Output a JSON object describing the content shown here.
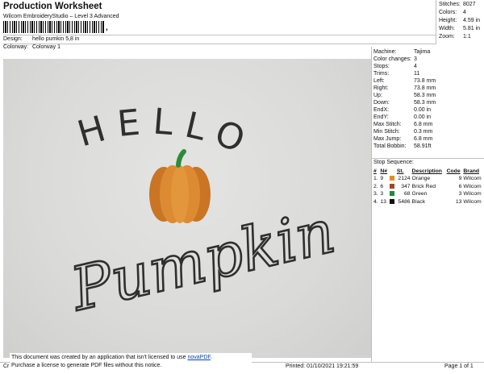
{
  "header": {
    "title": "Production Worksheet",
    "subtitle": "Wilcom EmbroideryStudio – Level 3 Advanced",
    "barcode_suffix": ","
  },
  "meta": {
    "design_label": "Design:",
    "design_value": "hello pumkin 5,8 in",
    "colorway_label": "Colorway:",
    "colorway_value": "Colorway 1"
  },
  "stats": [
    {
      "label": "Stitches:",
      "value": "8027"
    },
    {
      "label": "Colors:",
      "value": "4"
    },
    {
      "label": "Height:",
      "value": "4.59 in"
    },
    {
      "label": "Width:",
      "value": "5.81 in"
    },
    {
      "label": "Zoom:",
      "value": "1:1"
    }
  ],
  "design": {
    "line1": "HELLO",
    "line2": "Pumpkin",
    "colors": {
      "text": "#2f2f2c",
      "pumpkin": "#d98a32",
      "pumpkin_shade": "#b8661c",
      "stem": "#2e8b3a"
    }
  },
  "machine": [
    {
      "k": "Machine:",
      "v": "Tajima"
    },
    {
      "k": "Color changes:",
      "v": "3"
    },
    {
      "k": "Stops:",
      "v": "4"
    },
    {
      "k": "Trims:",
      "v": "11"
    },
    {
      "k": "Left:",
      "v": "73.8 mm"
    },
    {
      "k": "Right:",
      "v": "73.8 mm"
    },
    {
      "k": "Up:",
      "v": "58.3 mm"
    },
    {
      "k": "Down:",
      "v": "58.3 mm"
    },
    {
      "k": "EndX:",
      "v": "0.00 in"
    },
    {
      "k": "EndY:",
      "v": "0.00 in"
    },
    {
      "k": "Max Stitch:",
      "v": "6.8 mm"
    },
    {
      "k": "Min Stitch:",
      "v": "0.3 mm"
    },
    {
      "k": "Max Jump:",
      "v": "6.8 mm"
    },
    {
      "k": "Total Bobbin:",
      "v": "58.91ft"
    }
  ],
  "stop_sequence": {
    "label": "Stop Sequence:",
    "headers": [
      "#",
      "N#",
      "",
      "St.",
      "Description",
      "Code",
      "Brand"
    ],
    "rows": [
      {
        "idx": "1.",
        "n": "9",
        "color": "#e38a2a",
        "st": "2124",
        "desc": "Orange",
        "code": "9",
        "brand": "Wilcom"
      },
      {
        "idx": "2.",
        "n": "6",
        "color": "#a1492a",
        "st": "347",
        "desc": "Brick Red",
        "code": "6",
        "brand": "Wilcom"
      },
      {
        "idx": "3.",
        "n": "3",
        "color": "#1f8a3b",
        "st": "68",
        "desc": "Green",
        "code": "3",
        "brand": "Wilcom"
      },
      {
        "idx": "4.",
        "n": "13",
        "color": "#111111",
        "st": "5486",
        "desc": "Black",
        "code": "13",
        "brand": "Wilcom"
      }
    ]
  },
  "footer": {
    "left": "Cr",
    "printed": "Printed: 01/10/2021 19:21:59",
    "page": "Page 1 of 1",
    "notice_line1": "This document was created by an application that isn't licensed to use ",
    "notice_link": "novaPDF",
    "notice_dot": ".",
    "notice_line2": "Purchase a license to generate PDF files without this notice."
  }
}
